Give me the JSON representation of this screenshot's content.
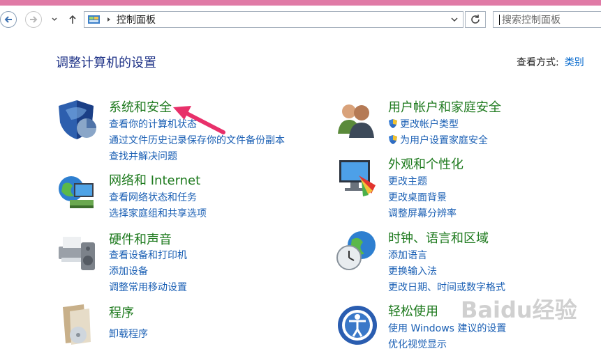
{
  "address": {
    "crumb": "控制面板"
  },
  "search": {
    "placeholder": "搜索控制面板"
  },
  "header": {
    "title": "调整计算机的设置",
    "view_by_label": "查看方式:",
    "view_by_value": "类别"
  },
  "categories": [
    {
      "name": "系统和安全",
      "links": [
        "查看你的计算机状态",
        "通过文件历史记录保存你的文件备份副本",
        "查找并解决问题"
      ]
    },
    {
      "name": "网络和 Internet",
      "links": [
        "查看网络状态和任务",
        "选择家庭组和共享选项"
      ]
    },
    {
      "name": "硬件和声音",
      "links": [
        "查看设备和打印机",
        "添加设备",
        "调整常用移动设置"
      ]
    },
    {
      "name": "程序",
      "links": [
        "卸载程序"
      ]
    },
    {
      "name": "用户帐户和家庭安全",
      "links": [
        "更改帐户类型",
        "为用户设置家庭安全"
      ]
    },
    {
      "name": "外观和个性化",
      "links": [
        "更改主题",
        "更改桌面背景",
        "调整屏幕分辨率"
      ]
    },
    {
      "name": "时钟、语言和区域",
      "links": [
        "添加语言",
        "更换输入法",
        "更改日期、时间或数字格式"
      ]
    },
    {
      "name": "轻松使用",
      "links": [
        "使用 Windows 建议的设置",
        "优化视觉显示"
      ]
    }
  ],
  "watermark": "Baidu经验",
  "colors": {
    "title": "#1e3287",
    "category": "#1e7a1e",
    "link": "#1a5fb4",
    "arrow": "#e8306a"
  }
}
